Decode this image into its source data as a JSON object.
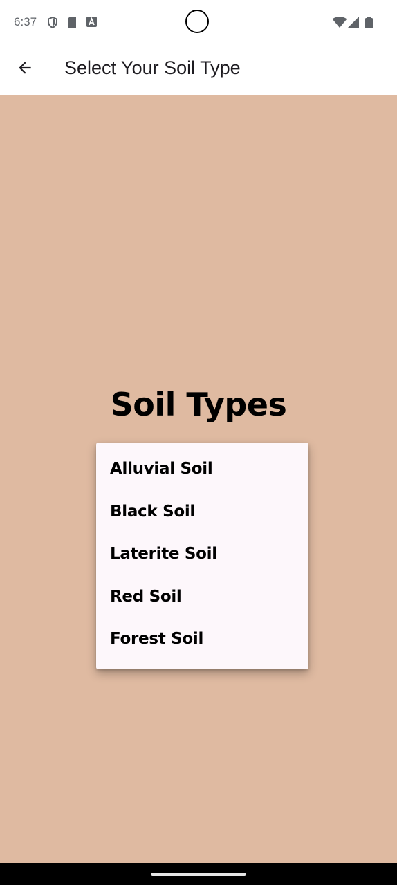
{
  "status_bar": {
    "time": "6:37",
    "left_icons": [
      "shield-icon",
      "sd-card-icon",
      "text-a-icon"
    ],
    "right_icons": [
      "wifi-icon",
      "cellular-signal-icon",
      "battery-icon"
    ]
  },
  "app_bar": {
    "back_icon": "arrow-back-icon",
    "title": "Select Your Soil Type"
  },
  "main": {
    "heading": "Soil Types",
    "background_color": "#dfbaa1",
    "menu": {
      "background_color": "#fdf7fb",
      "items": [
        {
          "label": "Alluvial Soil"
        },
        {
          "label": "Black Soil"
        },
        {
          "label": "Laterite Soil"
        },
        {
          "label": "Red Soil"
        },
        {
          "label": "Forest Soil"
        }
      ]
    }
  }
}
